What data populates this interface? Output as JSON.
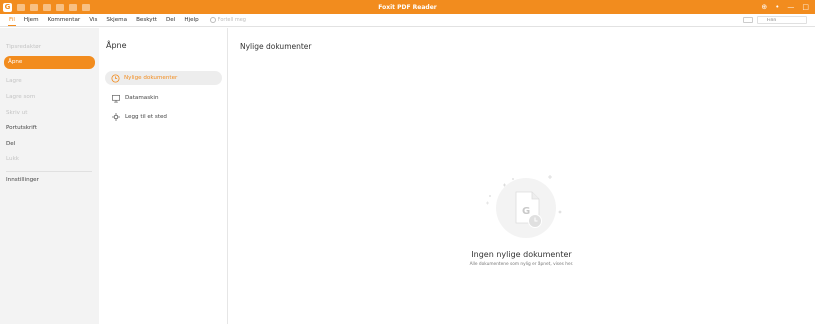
{
  "app": {
    "title": "Foxit PDF Reader",
    "logo_icon": "foxit-logo-icon",
    "accent": "#f28c1e",
    "window_controls": [
      "⊕",
      "•",
      "—",
      "□"
    ]
  },
  "menubar": {
    "items": [
      {
        "label": "Fil",
        "active": true
      },
      {
        "label": "Hjem"
      },
      {
        "label": "Kommentar"
      },
      {
        "label": "Vis"
      },
      {
        "label": "Skjema"
      },
      {
        "label": "Beskytt"
      },
      {
        "label": "Del"
      },
      {
        "label": "Hjelp"
      }
    ],
    "tell_me": "Fortell meg",
    "search_placeholder": "Finn"
  },
  "leftnav": {
    "items": [
      {
        "label": "Tipsredaktør",
        "state": "dim"
      },
      {
        "label": "Åpne",
        "state": "selected"
      },
      {
        "label": "Lagre",
        "state": "dim"
      },
      {
        "label": "Lagre som",
        "state": "dim"
      },
      {
        "label": "Skriv ut",
        "state": "dim"
      },
      {
        "label": "Portutskrift",
        "state": "normal"
      },
      {
        "label": "Del",
        "state": "normal"
      },
      {
        "label": "Lukk",
        "state": "dim"
      },
      {
        "label": "Innstillinger",
        "state": "normal"
      }
    ]
  },
  "middle": {
    "heading": "Åpne",
    "items": [
      {
        "label": "Nylige dokumenter",
        "icon": "clock-icon",
        "selected": true
      },
      {
        "label": "Datamaskin",
        "icon": "computer-icon"
      },
      {
        "label": "Legg til et sted",
        "icon": "add-place-icon"
      }
    ]
  },
  "main": {
    "heading": "Nylige dokumenter",
    "empty_title": "Ingen nylige dokumenter",
    "empty_subtitle": "Alle dokumentene som nylig er åpnet, vises her."
  }
}
